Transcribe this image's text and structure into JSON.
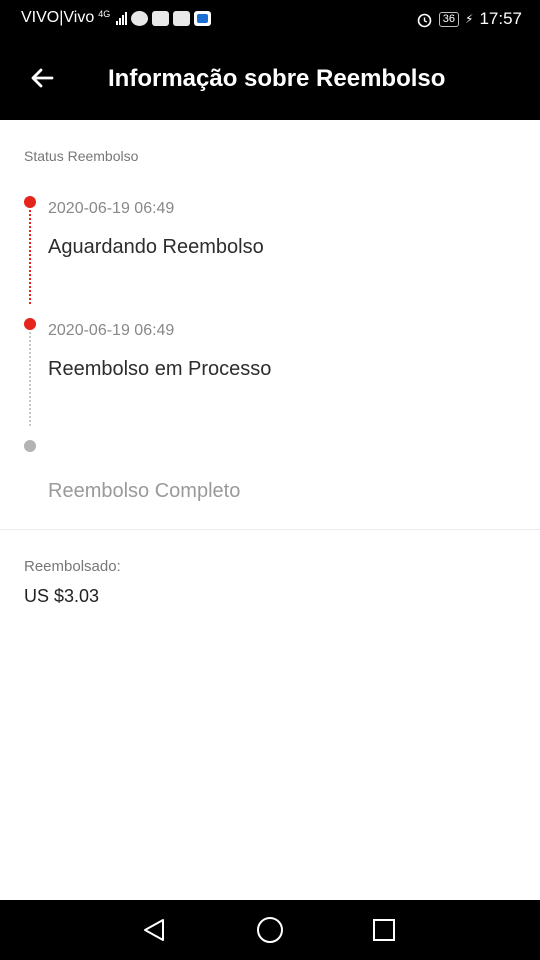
{
  "status_bar": {
    "carrier": "VIVO|Vivo",
    "network": "4G",
    "battery": "36",
    "time": "17:57"
  },
  "header": {
    "title": "Informação sobre Reembolso"
  },
  "status_section": {
    "label": "Status Reembolso",
    "steps": [
      {
        "time": "2020-06-19 06:49",
        "label": "Aguardando Reembolso",
        "state": "done"
      },
      {
        "time": "2020-06-19 06:49",
        "label": "Reembolso em Processo",
        "state": "done"
      },
      {
        "time": "",
        "label": "Reembolso Completo",
        "state": "pending"
      }
    ]
  },
  "refund": {
    "label": "Reembolsado:",
    "amount": "US $3.03"
  },
  "colors": {
    "accent": "#e5241b",
    "pending": "#b3b3b3",
    "header_bg": "#000000"
  }
}
